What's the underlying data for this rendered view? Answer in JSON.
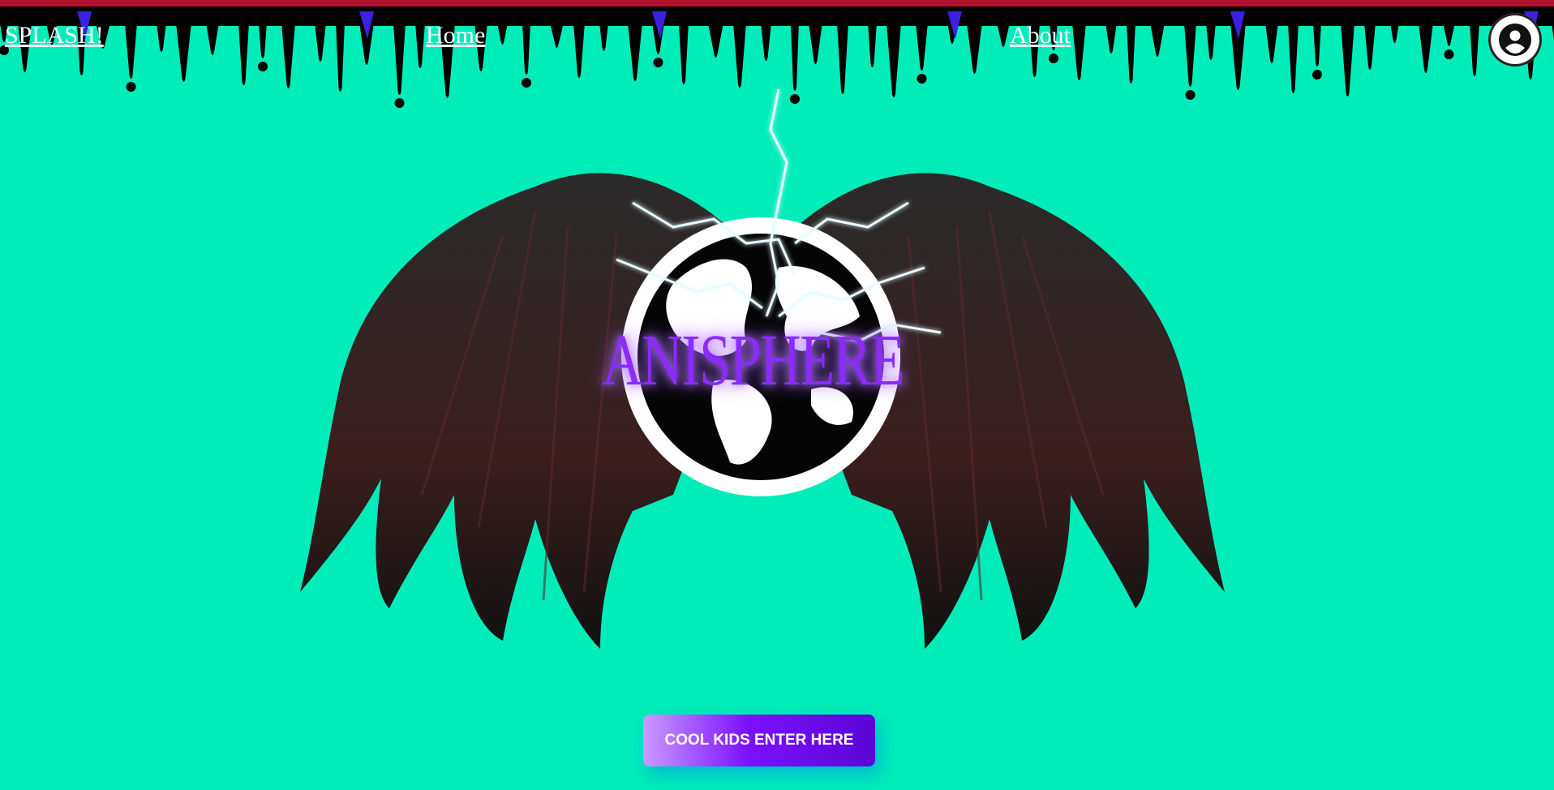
{
  "nav": {
    "brand": "SPLASH!",
    "home": "Home",
    "about": "About"
  },
  "icons": {
    "account": "account-circle-icon"
  },
  "hero": {
    "logo_text": "ANISPHERE"
  },
  "cta": {
    "label": "COOL KIDS ENTER HERE"
  },
  "colors": {
    "background": "#00EDB9",
    "top_stripe": "#b3122e",
    "drip": "#000000",
    "drip_accent": "#3b22e0",
    "logo_text": "#8a2cff",
    "cta_start": "#c99bff",
    "cta_end": "#5a06d4"
  }
}
